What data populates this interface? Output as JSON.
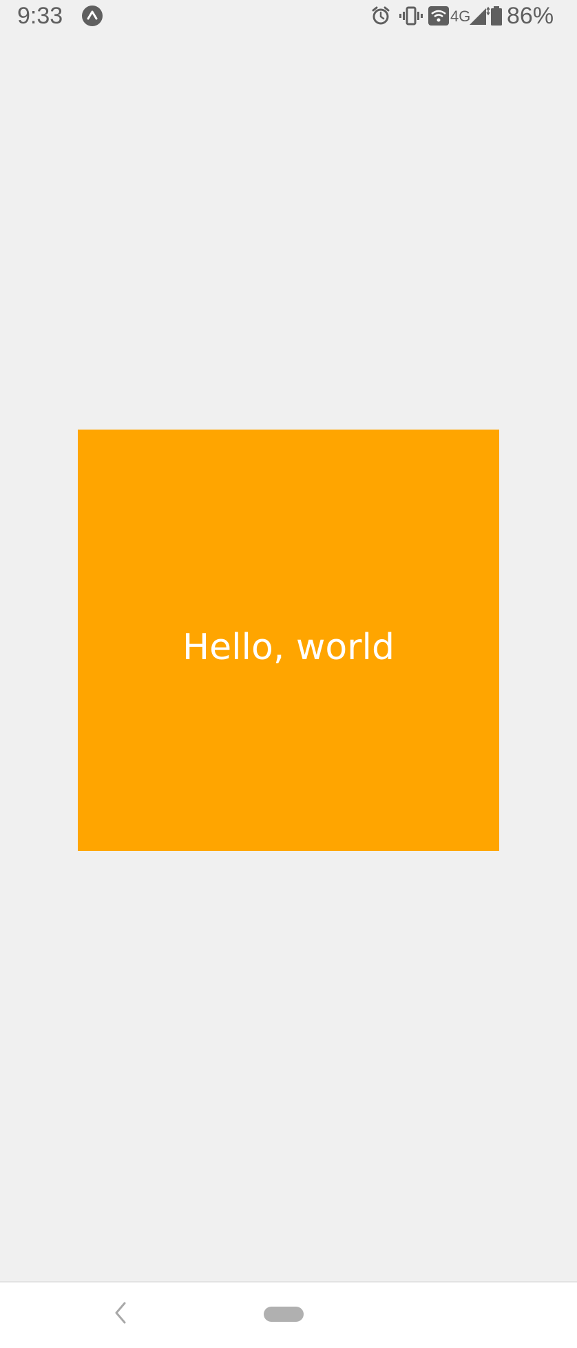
{
  "status_bar": {
    "time": "9:33",
    "network_type": "4G",
    "battery_percent": "86%",
    "icons": [
      "expo-icon",
      "alarm-icon",
      "vibrate-icon",
      "wifi-icon",
      "signal-icon",
      "battery-icon"
    ]
  },
  "main": {
    "box_text": "Hello, world",
    "box_color": "#ffa500",
    "background_color": "#f0f0f0",
    "text_color": "#ffffff"
  },
  "nav_bar": {
    "icons": [
      "back-icon",
      "home-pill"
    ]
  }
}
